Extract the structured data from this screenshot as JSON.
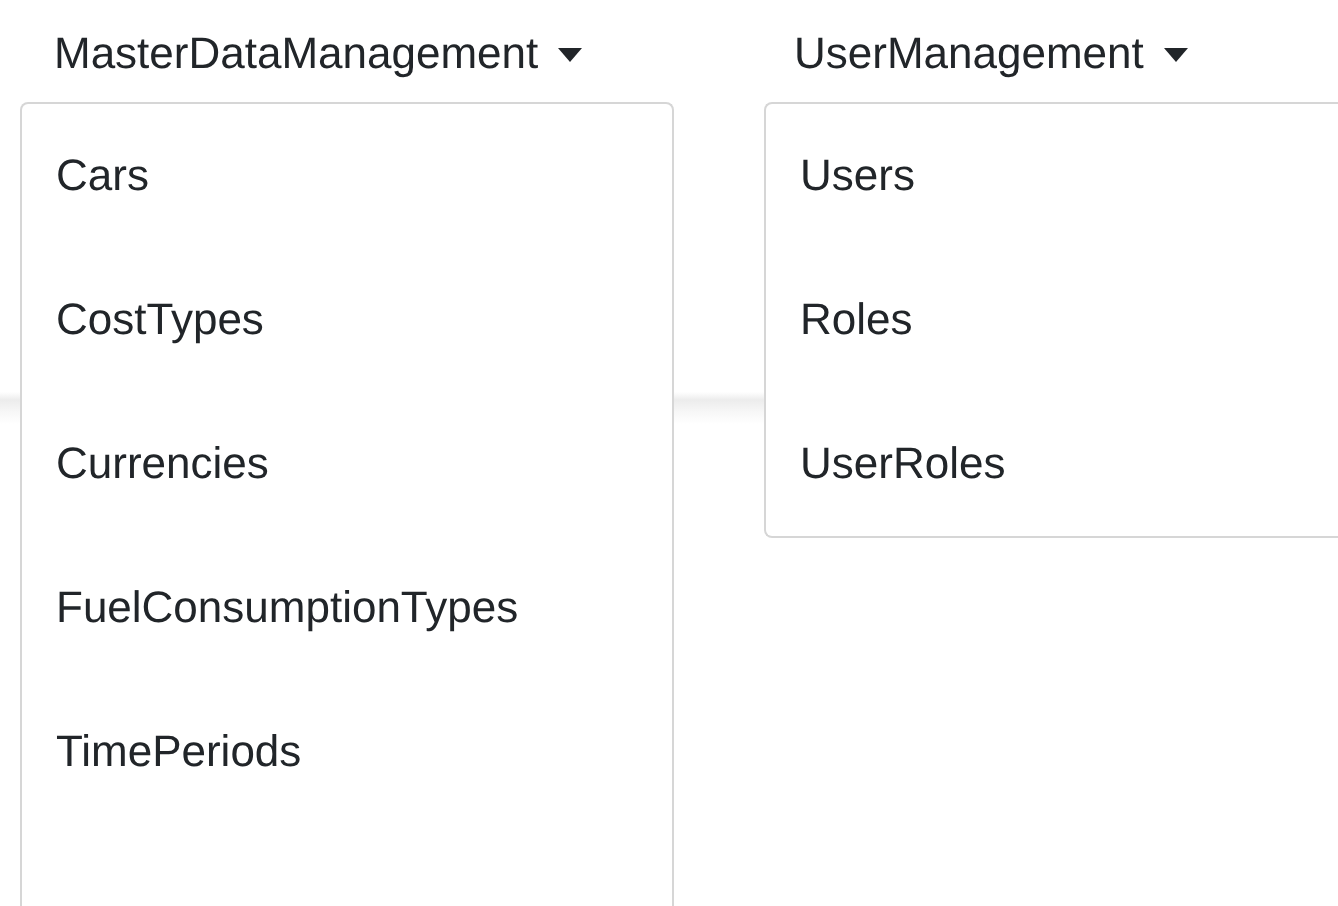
{
  "menus": [
    {
      "label": "MasterDataManagement",
      "expanded": true,
      "items": [
        "Cars",
        "CostTypes",
        "Currencies",
        "FuelConsumptionTypes",
        "TimePeriods"
      ]
    },
    {
      "label": "UserManagement",
      "expanded": true,
      "items": [
        "Users",
        "Roles",
        "UserRoles"
      ]
    }
  ]
}
